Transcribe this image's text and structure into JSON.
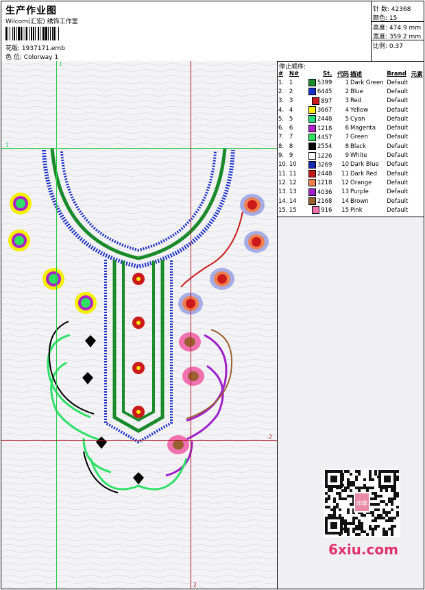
{
  "header": {
    "title": "生产作业图",
    "studio": "Wilcom(汇宏) 绣饰工作室",
    "pattern_label": "花版:",
    "pattern_value": "1937171.emb",
    "colorway_label": "色 位:",
    "colorway_value": "Colorway 1"
  },
  "stats": [
    {
      "label": "针 数:",
      "value": "42368"
    },
    {
      "label": "颜色:",
      "value": "15"
    },
    {
      "label": "高度:",
      "value": "474.9 mm"
    },
    {
      "label": "宽度:",
      "value": "359.2 mm"
    },
    {
      "label": "比例:",
      "value": "0.37"
    }
  ],
  "guides": {
    "v1": "1",
    "h1": "1",
    "v2": "2",
    "h2": "2"
  },
  "legend": {
    "heading": "停止顺序:",
    "columns": [
      "#",
      "N#",
      "St.",
      "代码",
      "描述",
      "Brand",
      "元素"
    ],
    "rows": [
      {
        "i": "1.",
        "n": "1",
        "st": "5399",
        "code": "1",
        "desc": "Dark Green",
        "brand": "Default",
        "color": "#1a8a2a"
      },
      {
        "i": "2.",
        "n": "2",
        "st": "6445",
        "code": "2",
        "desc": "Blue",
        "brand": "Default",
        "color": "#1b2ec8"
      },
      {
        "i": "3.",
        "n": "3",
        "st": "897",
        "code": "3",
        "desc": "Red",
        "brand": "Default",
        "color": "#cc1a1a"
      },
      {
        "i": "4.",
        "n": "4",
        "st": "3667",
        "code": "4",
        "desc": "Yellow",
        "brand": "Default",
        "color": "#f5f000"
      },
      {
        "i": "5.",
        "n": "5",
        "st": "2448",
        "code": "5",
        "desc": "Cyan",
        "brand": "Default",
        "color": "#22dd77"
      },
      {
        "i": "6.",
        "n": "6",
        "st": "1218",
        "code": "6",
        "desc": "Magenta",
        "brand": "Default",
        "color": "#b01ec8"
      },
      {
        "i": "7.",
        "n": "7",
        "st": "4457",
        "code": "7",
        "desc": "Green",
        "brand": "Default",
        "color": "#2ee066"
      },
      {
        "i": "8.",
        "n": "8",
        "st": "2554",
        "code": "8",
        "desc": "Black",
        "brand": "Default",
        "color": "#000000"
      },
      {
        "i": "9.",
        "n": "9",
        "st": "1226",
        "code": "9",
        "desc": "White",
        "brand": "Default",
        "color": "#f4f4f4"
      },
      {
        "i": "10.",
        "n": "10",
        "st": "3269",
        "code": "10",
        "desc": "Dark Blue",
        "brand": "Default",
        "color": "#1228b0"
      },
      {
        "i": "11.",
        "n": "11",
        "st": "2448",
        "code": "11",
        "desc": "Dark Red",
        "brand": "Default",
        "color": "#c01818"
      },
      {
        "i": "12.",
        "n": "12",
        "st": "1218",
        "code": "12",
        "desc": "Orange",
        "brand": "Default",
        "color": "#f08050"
      },
      {
        "i": "13.",
        "n": "13",
        "st": "4036",
        "code": "13",
        "desc": "Purple",
        "brand": "Default",
        "color": "#a020c8"
      },
      {
        "i": "14.",
        "n": "14",
        "st": "2168",
        "code": "14",
        "desc": "Brown",
        "brand": "Default",
        "color": "#9a6030"
      },
      {
        "i": "15.",
        "n": "15",
        "st": "916",
        "code": "15",
        "desc": "Pink",
        "brand": "Default",
        "color": "#f070b0"
      }
    ]
  },
  "watermark": "6xiu.com",
  "qr_stamp": "印章"
}
